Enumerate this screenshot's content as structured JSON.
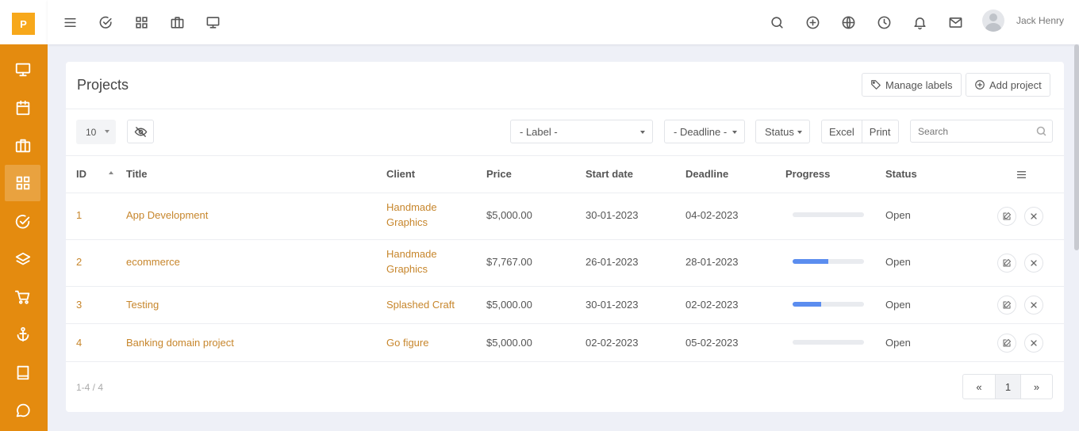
{
  "brand": {
    "logo_letter": "P"
  },
  "topbar": {
    "user_name": "Jack Henry"
  },
  "card": {
    "title": "Projects",
    "manage_labels": "Manage labels",
    "add_project": "Add project"
  },
  "toolbar": {
    "page_size": "10",
    "label_filter": "- Label -",
    "deadline_filter": "- Deadline -",
    "status_filter": "Status",
    "excel": "Excel",
    "print": "Print",
    "search_placeholder": "Search"
  },
  "table": {
    "headers": [
      "ID",
      "Title",
      "Client",
      "Price",
      "Start date",
      "Deadline",
      "Progress",
      "Status"
    ],
    "rows": [
      {
        "id": "1",
        "title": "App Development",
        "client": "Handmade Graphics",
        "client_l1": "Handmade",
        "client_l2": "Graphics",
        "price": "$5,000.00",
        "start": "30-01-2023",
        "deadline": "04-02-2023",
        "progress": 0,
        "status": "Open"
      },
      {
        "id": "2",
        "title": "ecommerce",
        "client": "Handmade Graphics",
        "client_l1": "Handmade",
        "client_l2": "Graphics",
        "price": "$7,767.00",
        "start": "26-01-2023",
        "deadline": "28-01-2023",
        "progress": 50,
        "status": "Open"
      },
      {
        "id": "3",
        "title": "Testing",
        "client": "Splashed Craft",
        "price": "$5,000.00",
        "start": "30-01-2023",
        "deadline": "02-02-2023",
        "progress": 40,
        "status": "Open"
      },
      {
        "id": "4",
        "title": "Banking domain project",
        "client": "Go figure",
        "price": "$5,000.00",
        "start": "02-02-2023",
        "deadline": "05-02-2023",
        "progress": 0,
        "status": "Open"
      }
    ]
  },
  "footer": {
    "range": "1-4 / 4",
    "prev": "«",
    "page": "1",
    "next": "»"
  },
  "colors": {
    "sidebar": "#e48b0f",
    "logo": "#f7a81b",
    "link": "#c7862c",
    "progress": "#5b8def"
  }
}
